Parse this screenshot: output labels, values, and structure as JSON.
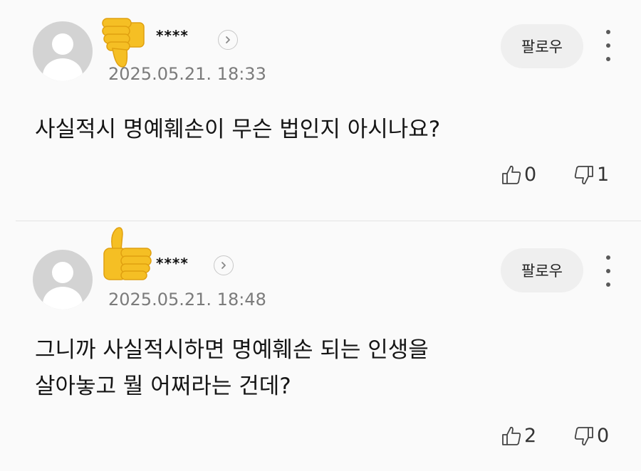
{
  "comments": [
    {
      "reaction_icon": "thumbs-down-emoji-icon",
      "username": "****",
      "date": "2025.05.21. 18:33",
      "follow_label": "팔로우",
      "text_lines": [
        "사실적시 명예훼손이 무슨 법인지 아시나요?"
      ],
      "likes": "0",
      "dislikes": "1"
    },
    {
      "reaction_icon": "thumbs-up-emoji-icon",
      "username": "****",
      "date": "2025.05.21. 18:48",
      "follow_label": "팔로우",
      "text_lines": [
        "그니까 사실적시하면 명예훼손 되는 인생을",
        "살아놓고 뭘 어쩌라는 건데?"
      ],
      "likes": "2",
      "dislikes": "0"
    }
  ],
  "colors": {
    "emoji_yellow": "#f5bf24",
    "date_gray": "#7b7b7b",
    "follow_bg": "#efefef"
  }
}
